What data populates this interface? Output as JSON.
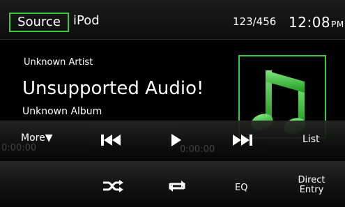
{
  "topbar": {
    "source_label": "Source",
    "source_name": "iPod",
    "track_count": "123/456",
    "time": "12:08",
    "ampm": "PM"
  },
  "now_playing": {
    "artist": "Unknown Artist",
    "title": "Unsupported Audio!",
    "album": "Unknown Album",
    "album_art": "music-note-icon"
  },
  "controls": {
    "more_label": "More▼",
    "list_label": "List",
    "prev_icon": "skip-previous-icon",
    "play_icon": "play-icon",
    "next_icon": "skip-next-icon",
    "elapsed": "0:00:00",
    "remaining": "0:00:00"
  },
  "controls2": {
    "shuffle_icon": "shuffle-icon",
    "repeat_icon": "repeat-icon",
    "eq_label": "EQ",
    "direct_label_line1": "Direct",
    "direct_label_line2": "Entry"
  },
  "colors": {
    "accent": "#3cc83c",
    "background": "#000000"
  }
}
